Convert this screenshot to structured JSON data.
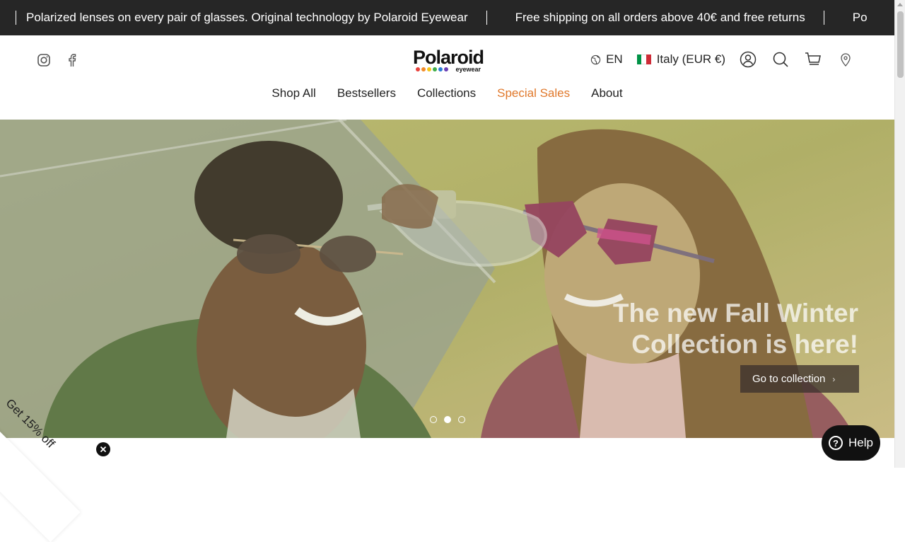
{
  "announcement": {
    "items": [
      "Polarized lenses on every pair of glasses. Original technology by Polaroid Eyewear",
      "Free shipping on all orders above 40€ and free returns",
      "Po"
    ]
  },
  "header": {
    "social": [
      "instagram-icon",
      "facebook-icon"
    ],
    "logo": {
      "word": "Polaroid",
      "sub": "eyewear",
      "dot_colors": [
        "#e8413c",
        "#f28c28",
        "#f5c518",
        "#3fae49",
        "#2b7bd6",
        "#6a3fb5"
      ]
    },
    "language": "EN",
    "country": "Italy (EUR €)",
    "flag_colors": [
      "#009246",
      "#ffffff",
      "#ce2b37"
    ],
    "icons": [
      "account-icon",
      "search-icon",
      "cart-icon",
      "store-locator-icon"
    ]
  },
  "nav": {
    "items": [
      "Shop All",
      "Bestsellers",
      "Collections",
      "Special Sales",
      "About"
    ],
    "highlight_color": "#e0782b"
  },
  "hero": {
    "title_line1": "The new Fall Winter",
    "title_line2": "Collection is here!",
    "cta_label": "Go to collection",
    "slides": 3,
    "active_slide": 2
  },
  "promo": {
    "label": "Get 15% off"
  },
  "help": {
    "label": "Help"
  }
}
